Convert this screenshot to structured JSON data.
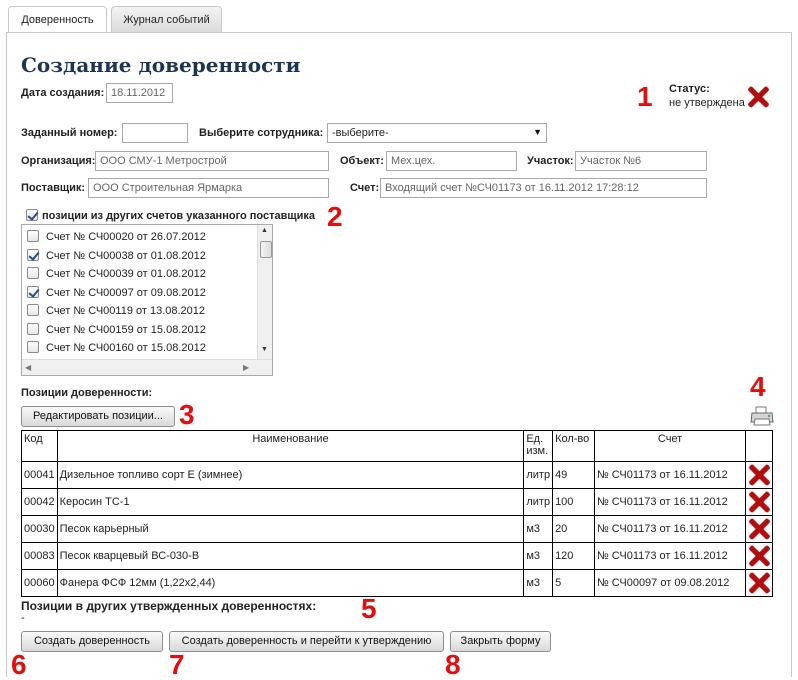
{
  "tabs": [
    {
      "label": "Доверенность",
      "active": true
    },
    {
      "label": "Журнал событий",
      "active": false
    }
  ],
  "page_title": "Создание доверенности",
  "created": {
    "label": "Дата создания:",
    "value": "18.11.2012"
  },
  "status": {
    "label": "Статус:",
    "value": "не утверждена"
  },
  "annotation_numbers": [
    "1",
    "2",
    "3",
    "4",
    "5",
    "6",
    "7",
    "8"
  ],
  "form": {
    "number_label": "Заданный номер:",
    "number_value": "",
    "employee_label": "Выберите сотрудника:",
    "employee_value": "-выберите-",
    "org_label": "Организация:",
    "org_value": "ООО СМУ-1 Метрострой",
    "object_label": "Объект:",
    "object_value": "Мех.цех.",
    "site_label": "Участок:",
    "site_value": "Участок №6",
    "supplier_label": "Поставщик:",
    "supplier_value": "ООО Строительная Ярмарка",
    "invoice_label": "Счет:",
    "invoice_value": "Входящий счет №СЧ01173 от 16.11.2012 17:28:12"
  },
  "other_invoices": {
    "label": "позиции из других счетов указанного поставщика",
    "checked": true,
    "items": [
      {
        "label": "Счет № СЧ00020 от 26.07.2012",
        "checked": false
      },
      {
        "label": "Счет № СЧ00038 от 01.08.2012",
        "checked": true
      },
      {
        "label": "Счет № СЧ00039 от 01.08.2012",
        "checked": false
      },
      {
        "label": "Счет № СЧ00097 от 09.08.2012",
        "checked": true
      },
      {
        "label": "Счет № СЧ00119 от 13.08.2012",
        "checked": false
      },
      {
        "label": "Счет № СЧ00159 от 15.08.2012",
        "checked": false
      },
      {
        "label": "Счет № СЧ00160 от 15.08.2012",
        "checked": false
      }
    ]
  },
  "positions": {
    "label": "Позиции доверенности:",
    "edit_button": "Редактировать позиции...",
    "columns": [
      "Код",
      "Наименование",
      "Ед. изм.",
      "Кол-во",
      "Счет"
    ],
    "rows": [
      {
        "code": "00041",
        "name": "Дизельное топливо сорт Е (зимнее)",
        "unit": "литр",
        "qty": "49",
        "invoice": "№ СЧ01173 от 16.11.2012"
      },
      {
        "code": "00042",
        "name": "Керосин ТС-1",
        "unit": "литр",
        "qty": "100",
        "invoice": "№ СЧ01173 от 16.11.2012"
      },
      {
        "code": "00030",
        "name": "Песок карьерный",
        "unit": "м3",
        "qty": "20",
        "invoice": "№ СЧ01173 от 16.11.2012"
      },
      {
        "code": "00083",
        "name": "Песок кварцевый ВС-030-В",
        "unit": "м3",
        "qty": "120",
        "invoice": "№ СЧ01173 от 16.11.2012"
      },
      {
        "code": "00060",
        "name": "Фанера ФСФ 12мм (1,22х2,44)",
        "unit": "м3",
        "qty": "5",
        "invoice": "№ СЧ00097 от 09.08.2012"
      }
    ]
  },
  "other_approved": {
    "label": "Позиции в других утвержденных доверенностях:",
    "value": "-"
  },
  "buttons": {
    "create": "Создать доверенность",
    "create_approve": "Создать доверенность и перейти к утверждению",
    "close": "Закрыть форму"
  },
  "icons": {
    "delete": "delete-x-icon",
    "print": "printer-icon",
    "status": "status-x-icon"
  },
  "colors": {
    "title": "#1e3453",
    "annotation": "#e01010",
    "delete": "#b40d0d"
  }
}
